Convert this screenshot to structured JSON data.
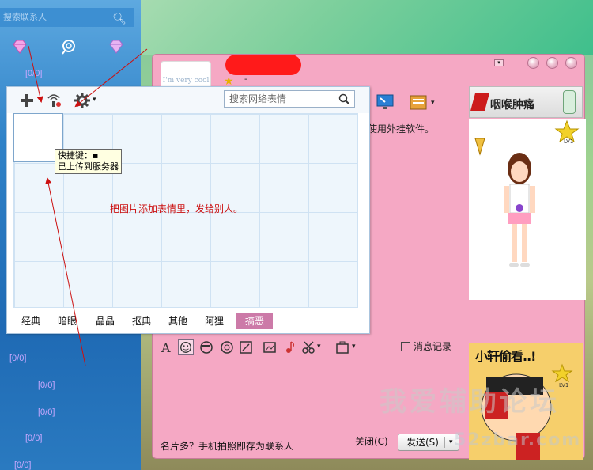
{
  "qq_panel": {
    "search_placeholder": "搜索联系人",
    "rows": [
      {
        "text": "[0/0]"
      },
      {
        "text": "[0/0]"
      },
      {
        "text": "[0/0]"
      },
      {
        "text": "[0/0]"
      },
      {
        "text": "[0/0]"
      },
      {
        "text": "[0/0]"
      },
      {
        "text": "[0/0]"
      }
    ]
  },
  "chat": {
    "tip": "使用外挂软件。",
    "history_label": "消息记录",
    "promo": "名片多？手机拍照即存为联系人",
    "close_label": "关闭(C)",
    "send_label": "发送(S)",
    "avatar_text": "I'm very cool"
  },
  "ads": {
    "top_title": "咽喉肿痛",
    "cartoon_title": "小轩偷看..!",
    "level": "LV1",
    "level2": "LV1"
  },
  "emoji_popup": {
    "search_placeholder": "搜索网络表情",
    "tooltip_line1": "快捷键：▪",
    "tooltip_line2": "已上传到服务器",
    "hint": "把图片添加表情里，发给别人。",
    "tabs": [
      {
        "label": "经典",
        "active": false
      },
      {
        "label": "暗眼",
        "active": false
      },
      {
        "label": "晶晶",
        "active": false
      },
      {
        "label": "抠典",
        "active": false
      },
      {
        "label": "其他",
        "active": false
      },
      {
        "label": "阿狸",
        "active": false
      },
      {
        "label": "搞恶",
        "active": true
      }
    ]
  },
  "watermark": {
    "text": "我爱辅助论坛",
    "text2": "52zbar.com"
  },
  "colors": {
    "chat_bg": "#f5a8c4",
    "panel_blue": "#2f82c8",
    "active_tab": "#cc7aa8",
    "hint_red": "#cc1010",
    "arrow_red": "#cc1010"
  }
}
